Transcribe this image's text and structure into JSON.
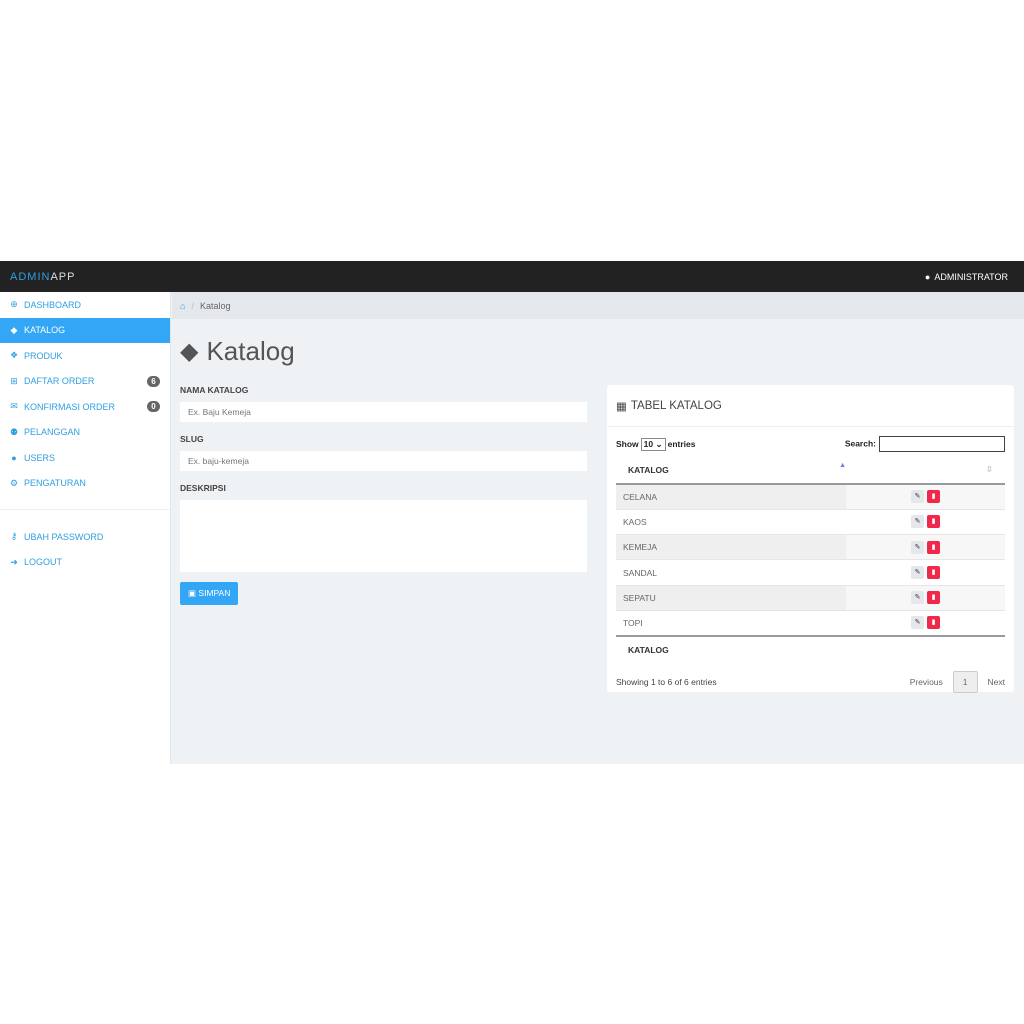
{
  "brand": {
    "part1": "ADMIN",
    "part2": "APP"
  },
  "user": {
    "name": "ADMINISTRATOR"
  },
  "sidebar": {
    "items": [
      {
        "label": "DASHBOARD",
        "icon": "dashboard-icon",
        "glyph": "⊕"
      },
      {
        "label": "KATALOG",
        "icon": "tags-icon",
        "glyph": "◆"
      },
      {
        "label": "PRODUK",
        "icon": "cubes-icon",
        "glyph": "❖"
      },
      {
        "label": "DAFTAR ORDER",
        "icon": "cart-icon",
        "glyph": "⊞",
        "badge": "6"
      },
      {
        "label": "KONFIRMASI ORDER",
        "icon": "envelope-icon",
        "glyph": "✉",
        "badge": "0"
      },
      {
        "label": "PELANGGAN",
        "icon": "users-icon",
        "glyph": "⚉"
      },
      {
        "label": "USERS",
        "icon": "user-icon",
        "glyph": "●"
      },
      {
        "label": "PENGATURAN",
        "icon": "cogs-icon",
        "glyph": "⚙"
      }
    ],
    "bottom": [
      {
        "label": "UBAH PASSWORD",
        "icon": "key-icon",
        "glyph": "⚷"
      },
      {
        "label": "LOGOUT",
        "icon": "sign-out-icon",
        "glyph": "➜"
      }
    ]
  },
  "breadcrumb": {
    "current": "Katalog"
  },
  "page": {
    "title": "Katalog"
  },
  "form": {
    "nama_label": "NAMA KATALOG",
    "nama_placeholder": "Ex. Baju Kemeja",
    "slug_label": "SLUG",
    "slug_placeholder": "Ex. baju-kemeja",
    "desc_label": "DESKRIPSI",
    "save": "SIMPAN"
  },
  "panel": {
    "title": "TABEL KATALOG",
    "show": "Show",
    "entries_value": "10",
    "entries": "entries",
    "search": "Search:",
    "col": "KATALOG",
    "footer_col": "KATALOG",
    "rows": [
      "CELANA",
      "KAOS",
      "KEMEJA",
      "SANDAL",
      "SEPATU",
      "TOPI"
    ],
    "info": "Showing 1 to 6 of 6 entries",
    "prev": "Previous",
    "page": "1",
    "next": "Next"
  }
}
